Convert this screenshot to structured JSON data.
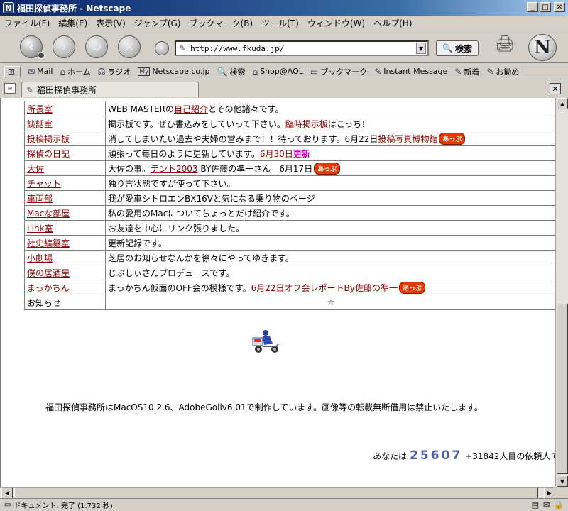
{
  "window": {
    "title": "福田探偵事務所 - Netscape",
    "app_icon": "N"
  },
  "menu": [
    "ファイル(F)",
    "編集(E)",
    "表示(V)",
    "ジャンプ(G)",
    "ブックマーク(B)",
    "ツール(T)",
    "ウィンドウ(W)",
    "ヘルプ(H)"
  ],
  "nav": {
    "url": "http://www.fkuda.jp/",
    "search_label": "検索",
    "logo_letter": "N"
  },
  "personal_toolbar": [
    {
      "label": "",
      "icon": "tab-icon"
    },
    {
      "label": "Mail",
      "icon": "mail-icon"
    },
    {
      "label": "ホーム",
      "icon": "home-icon"
    },
    {
      "label": "ラジオ",
      "icon": "headphones-icon"
    },
    {
      "label": "Netscape.co.jp",
      "icon": "my-icon"
    },
    {
      "label": "検索",
      "icon": "search-icon"
    },
    {
      "label": "Shop@AOL",
      "icon": "shop-icon"
    },
    {
      "label": "ブックマーク",
      "icon": "bookmark-icon"
    },
    {
      "label": "Instant Message",
      "icon": "link-icon"
    },
    {
      "label": "新着",
      "icon": "link-icon"
    },
    {
      "label": "お勧め",
      "icon": "link-icon"
    }
  ],
  "tab": {
    "label": "福田探偵事務所"
  },
  "table": {
    "rows": [
      {
        "name": "所長室",
        "pre": "WEB MASTERの",
        "link": "自己紹介",
        "post": "とその他諸々です。",
        "badge": ""
      },
      {
        "name": "談話室",
        "pre": "掲示板です。ぜひ書込みをしていって下さい。",
        "link": "臨時掲示板",
        "post": "はこっち！",
        "badge": ""
      },
      {
        "name": "投稿掲示板",
        "pre": "消してしまいたい過去や夫婦の営みまで！！待っております。6月22日",
        "link": "投稿写真博物館",
        "post": "",
        "badge": "あっぷ"
      },
      {
        "name": "探偵の日記",
        "pre": "頑張って毎日のように更新しています。",
        "link": "6月30日",
        "post": "",
        "update": "更新",
        "badge": ""
      },
      {
        "name": "大佐",
        "pre": "大佐の事。",
        "link": "テント2003",
        "post": " BY佐藤の準一さん　6月17日",
        "badge": "あっぷ"
      },
      {
        "name": "チャット",
        "pre": "独り言状態ですが使って下さい。",
        "link": "",
        "post": "",
        "badge": ""
      },
      {
        "name": "車両部",
        "pre": "我が愛車シトロエンBX16Vと気になる乗り物のページ",
        "link": "",
        "post": "",
        "badge": ""
      },
      {
        "name": "Macな部屋",
        "pre": "私の愛用のMacについてちょっとだけ紹介です。",
        "link": "",
        "post": "",
        "badge": ""
      },
      {
        "name": "Link室",
        "pre": "お友達を中心にリンク張りました。",
        "link": "",
        "post": "",
        "badge": ""
      },
      {
        "name": "社史編纂室",
        "pre": "更新記録です。",
        "link": "",
        "post": "",
        "badge": ""
      },
      {
        "name": "小劇場",
        "pre": "芝居のお知らせなんかを徐々にやってゆきます。",
        "link": "",
        "post": "",
        "badge": ""
      },
      {
        "name": "僕の居酒屋",
        "pre": "じぶしぃさんプロデュースです。",
        "link": "",
        "post": "",
        "badge": ""
      },
      {
        "name": "まっかちん",
        "pre": "まっかちん仮面のOFF会の模様です。",
        "link": "6月22日オフ会レポートBy佐藤の準一",
        "post": "",
        "badge": "あっぷ"
      }
    ],
    "notice_label": "お知らせ",
    "notice_value": "☆"
  },
  "footer": "福田探偵事務所はMacOS10.2.6、AdobeGoliv6.01で制作しています。画像等の転載無断借用は禁止いたします。",
  "counter": {
    "prefix": "あなたは",
    "number": "25607",
    "suffix": "+31842人目の依頼人で"
  },
  "status": {
    "text": "ドキュメント: 完了 (1.732 秒)"
  }
}
